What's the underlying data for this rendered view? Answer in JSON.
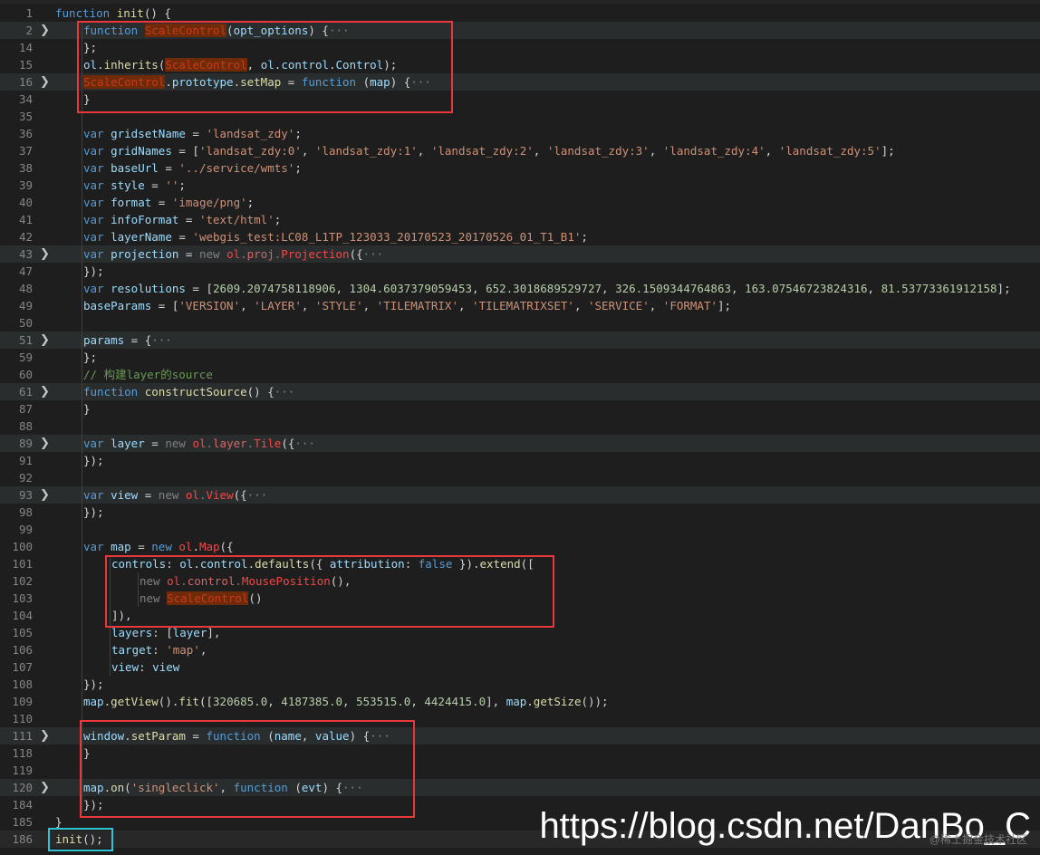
{
  "watermark": "https://blog.csdn.net/DanBo_C",
  "watermark_sub": "@稀土掘金技术社区",
  "lines": [
    {
      "n": "1",
      "fold": false,
      "indent": 0,
      "tokens": [
        [
          "k",
          "function "
        ],
        [
          "f",
          "init"
        ],
        [
          "d",
          "() {"
        ]
      ]
    },
    {
      "n": "2",
      "fold": true,
      "indent": 1,
      "tokens": [
        [
          "k",
          "function "
        ],
        [
          "hl",
          "ScaleControl"
        ],
        [
          "d",
          "("
        ],
        [
          "v",
          "opt_options"
        ],
        [
          "d",
          ") {"
        ],
        [
          "gray",
          "···"
        ]
      ]
    },
    {
      "n": "14",
      "fold": false,
      "indent": 1,
      "tokens": [
        [
          "d",
          "};"
        ]
      ]
    },
    {
      "n": "15",
      "fold": false,
      "indent": 1,
      "tokens": [
        [
          "v",
          "ol"
        ],
        [
          "d",
          "."
        ],
        [
          "f",
          "inherits"
        ],
        [
          "d",
          "("
        ],
        [
          "hl",
          "ScaleControl"
        ],
        [
          "d",
          ", "
        ],
        [
          "v",
          "ol"
        ],
        [
          "d",
          "."
        ],
        [
          "v",
          "control"
        ],
        [
          "d",
          "."
        ],
        [
          "v",
          "Control"
        ],
        [
          "d",
          ");"
        ]
      ]
    },
    {
      "n": "16",
      "fold": true,
      "indent": 1,
      "tokens": [
        [
          "hl",
          "ScaleControl"
        ],
        [
          "d",
          "."
        ],
        [
          "v",
          "prototype"
        ],
        [
          "d",
          "."
        ],
        [
          "f",
          "setMap"
        ],
        [
          "d",
          " = "
        ],
        [
          "k",
          "function "
        ],
        [
          "d",
          "("
        ],
        [
          "v",
          "map"
        ],
        [
          "d",
          ") {"
        ],
        [
          "gray",
          "···"
        ]
      ]
    },
    {
      "n": "34",
      "fold": false,
      "indent": 1,
      "tokens": [
        [
          "d",
          "}"
        ]
      ]
    },
    {
      "n": "35",
      "fold": false,
      "indent": 1,
      "tokens": []
    },
    {
      "n": "36",
      "fold": false,
      "indent": 1,
      "tokens": [
        [
          "k",
          "var "
        ],
        [
          "v",
          "gridsetName"
        ],
        [
          "d",
          " = "
        ],
        [
          "s",
          "'landsat_zdy'"
        ],
        [
          "d",
          ";"
        ]
      ]
    },
    {
      "n": "37",
      "fold": false,
      "indent": 1,
      "tokens": [
        [
          "k",
          "var "
        ],
        [
          "v",
          "gridNames"
        ],
        [
          "d",
          " = ["
        ],
        [
          "s",
          "'landsat_zdy:0'"
        ],
        [
          "d",
          ", "
        ],
        [
          "s",
          "'landsat_zdy:1'"
        ],
        [
          "d",
          ", "
        ],
        [
          "s",
          "'landsat_zdy:2'"
        ],
        [
          "d",
          ", "
        ],
        [
          "s",
          "'landsat_zdy:3'"
        ],
        [
          "d",
          ", "
        ],
        [
          "s",
          "'landsat_zdy:4'"
        ],
        [
          "d",
          ", "
        ],
        [
          "s",
          "'landsat_zdy:5'"
        ],
        [
          "d",
          "];"
        ]
      ]
    },
    {
      "n": "38",
      "fold": false,
      "indent": 1,
      "tokens": [
        [
          "k",
          "var "
        ],
        [
          "v",
          "baseUrl"
        ],
        [
          "d",
          " = "
        ],
        [
          "s",
          "'../service/wmts'"
        ],
        [
          "d",
          ";"
        ]
      ]
    },
    {
      "n": "39",
      "fold": false,
      "indent": 1,
      "tokens": [
        [
          "k",
          "var "
        ],
        [
          "v",
          "style"
        ],
        [
          "d",
          " = "
        ],
        [
          "s",
          "''"
        ],
        [
          "d",
          ";"
        ]
      ]
    },
    {
      "n": "40",
      "fold": false,
      "indent": 1,
      "tokens": [
        [
          "k",
          "var "
        ],
        [
          "v",
          "format"
        ],
        [
          "d",
          " = "
        ],
        [
          "s",
          "'image/png'"
        ],
        [
          "d",
          ";"
        ]
      ]
    },
    {
      "n": "41",
      "fold": false,
      "indent": 1,
      "tokens": [
        [
          "k",
          "var "
        ],
        [
          "v",
          "infoFormat"
        ],
        [
          "d",
          " = "
        ],
        [
          "s",
          "'text/html'"
        ],
        [
          "d",
          ";"
        ]
      ]
    },
    {
      "n": "42",
      "fold": false,
      "indent": 1,
      "tokens": [
        [
          "k",
          "var "
        ],
        [
          "v",
          "layerName"
        ],
        [
          "d",
          " = "
        ],
        [
          "s",
          "'webgis_test:LC08_L1TP_123033_20170523_20170526_01_T1_B1'"
        ],
        [
          "d",
          ";"
        ]
      ]
    },
    {
      "n": "43",
      "fold": true,
      "indent": 1,
      "tokens": [
        [
          "k",
          "var "
        ],
        [
          "v",
          "projection"
        ],
        [
          "d",
          " = "
        ],
        [
          "gray",
          "new "
        ],
        [
          "err",
          "ol"
        ],
        [
          "gray",
          "."
        ],
        [
          "err2",
          "proj"
        ],
        [
          "gray",
          "."
        ],
        [
          "err",
          "Projection"
        ],
        [
          "d",
          "({"
        ],
        [
          "gray",
          "···"
        ]
      ]
    },
    {
      "n": "47",
      "fold": false,
      "indent": 1,
      "tokens": [
        [
          "d",
          "});"
        ]
      ]
    },
    {
      "n": "48",
      "fold": false,
      "indent": 1,
      "tokens": [
        [
          "k",
          "var "
        ],
        [
          "v",
          "resolutions"
        ],
        [
          "d",
          " = ["
        ],
        [
          "n",
          "2609.2074758118906"
        ],
        [
          "d",
          ", "
        ],
        [
          "n",
          "1304.6037379059453"
        ],
        [
          "d",
          ", "
        ],
        [
          "n",
          "652.3018689529727"
        ],
        [
          "d",
          ", "
        ],
        [
          "n",
          "326.1509344764863"
        ],
        [
          "d",
          ", "
        ],
        [
          "n",
          "163.07546723824316"
        ],
        [
          "d",
          ", "
        ],
        [
          "n",
          "81.53773361912158"
        ],
        [
          "d",
          "];"
        ]
      ]
    },
    {
      "n": "49",
      "fold": false,
      "indent": 1,
      "tokens": [
        [
          "v",
          "baseParams"
        ],
        [
          "d",
          " = ["
        ],
        [
          "s",
          "'VERSION'"
        ],
        [
          "d",
          ", "
        ],
        [
          "s",
          "'LAYER'"
        ],
        [
          "d",
          ", "
        ],
        [
          "s",
          "'STYLE'"
        ],
        [
          "d",
          ", "
        ],
        [
          "s",
          "'TILEMATRIX'"
        ],
        [
          "d",
          ", "
        ],
        [
          "s",
          "'TILEMATRIXSET'"
        ],
        [
          "d",
          ", "
        ],
        [
          "s",
          "'SERVICE'"
        ],
        [
          "d",
          ", "
        ],
        [
          "s",
          "'FORMAT'"
        ],
        [
          "d",
          "];"
        ]
      ]
    },
    {
      "n": "50",
      "fold": false,
      "indent": 1,
      "tokens": []
    },
    {
      "n": "51",
      "fold": true,
      "indent": 1,
      "tokens": [
        [
          "v",
          "params"
        ],
        [
          "d",
          " = {"
        ],
        [
          "gray",
          "···"
        ]
      ]
    },
    {
      "n": "59",
      "fold": false,
      "indent": 1,
      "tokens": [
        [
          "d",
          "};"
        ]
      ]
    },
    {
      "n": "60",
      "fold": false,
      "indent": 1,
      "tokens": [
        [
          "c",
          "// 构建layer的source"
        ]
      ]
    },
    {
      "n": "61",
      "fold": true,
      "indent": 1,
      "tokens": [
        [
          "k",
          "function "
        ],
        [
          "f",
          "constructSource"
        ],
        [
          "d",
          "() {"
        ],
        [
          "gray",
          "···"
        ]
      ]
    },
    {
      "n": "87",
      "fold": false,
      "indent": 1,
      "tokens": [
        [
          "d",
          "}"
        ]
      ]
    },
    {
      "n": "88",
      "fold": false,
      "indent": 1,
      "tokens": []
    },
    {
      "n": "89",
      "fold": true,
      "indent": 1,
      "tokens": [
        [
          "k",
          "var "
        ],
        [
          "v",
          "layer"
        ],
        [
          "d",
          " = "
        ],
        [
          "gray",
          "new "
        ],
        [
          "err",
          "ol"
        ],
        [
          "gray",
          "."
        ],
        [
          "err2",
          "layer"
        ],
        [
          "gray",
          "."
        ],
        [
          "err",
          "Tile"
        ],
        [
          "d",
          "({"
        ],
        [
          "gray",
          "···"
        ]
      ]
    },
    {
      "n": "91",
      "fold": false,
      "indent": 1,
      "tokens": [
        [
          "d",
          "});"
        ]
      ]
    },
    {
      "n": "92",
      "fold": false,
      "indent": 1,
      "tokens": []
    },
    {
      "n": "93",
      "fold": true,
      "indent": 1,
      "tokens": [
        [
          "k",
          "var "
        ],
        [
          "v",
          "view"
        ],
        [
          "d",
          " = "
        ],
        [
          "gray",
          "new "
        ],
        [
          "err",
          "ol"
        ],
        [
          "gray",
          "."
        ],
        [
          "err",
          "View"
        ],
        [
          "d",
          "({"
        ],
        [
          "gray",
          "···"
        ]
      ]
    },
    {
      "n": "98",
      "fold": false,
      "indent": 1,
      "tokens": [
        [
          "d",
          "});"
        ]
      ]
    },
    {
      "n": "99",
      "fold": false,
      "indent": 1,
      "tokens": []
    },
    {
      "n": "100",
      "fold": false,
      "indent": 1,
      "tokens": [
        [
          "k",
          "var "
        ],
        [
          "v",
          "map"
        ],
        [
          "d",
          " = "
        ],
        [
          "k",
          "new "
        ],
        [
          "err",
          "ol"
        ],
        [
          "d",
          "."
        ],
        [
          "err",
          "Map"
        ],
        [
          "d",
          "({"
        ]
      ]
    },
    {
      "n": "101",
      "fold": false,
      "indent": 2,
      "tokens": [
        [
          "v",
          "controls"
        ],
        [
          "d",
          ": "
        ],
        [
          "v",
          "ol"
        ],
        [
          "d",
          "."
        ],
        [
          "v",
          "control"
        ],
        [
          "d",
          "."
        ],
        [
          "f",
          "defaults"
        ],
        [
          "d",
          "({ "
        ],
        [
          "v",
          "attribution"
        ],
        [
          "d",
          ": "
        ],
        [
          "k",
          "false"
        ],
        [
          "d",
          " })."
        ],
        [
          "f",
          "extend"
        ],
        [
          "d",
          "(["
        ]
      ]
    },
    {
      "n": "102",
      "fold": false,
      "indent": 3,
      "tokens": [
        [
          "gray",
          "new "
        ],
        [
          "err",
          "ol"
        ],
        [
          "gray",
          "."
        ],
        [
          "err2",
          "control"
        ],
        [
          "gray",
          "."
        ],
        [
          "err",
          "MousePosition"
        ],
        [
          "d",
          "(),"
        ]
      ]
    },
    {
      "n": "103",
      "fold": false,
      "indent": 3,
      "tokens": [
        [
          "gray",
          "new "
        ],
        [
          "hl",
          "ScaleControl"
        ],
        [
          "d",
          "()"
        ]
      ]
    },
    {
      "n": "104",
      "fold": false,
      "indent": 2,
      "tokens": [
        [
          "d",
          "]),"
        ]
      ]
    },
    {
      "n": "105",
      "fold": false,
      "indent": 2,
      "tokens": [
        [
          "v",
          "layers"
        ],
        [
          "d",
          ": ["
        ],
        [
          "v",
          "layer"
        ],
        [
          "d",
          "],"
        ]
      ]
    },
    {
      "n": "106",
      "fold": false,
      "indent": 2,
      "tokens": [
        [
          "v",
          "target"
        ],
        [
          "d",
          ": "
        ],
        [
          "s",
          "'map'"
        ],
        [
          "d",
          ","
        ]
      ]
    },
    {
      "n": "107",
      "fold": false,
      "indent": 2,
      "tokens": [
        [
          "v",
          "view"
        ],
        [
          "d",
          ": "
        ],
        [
          "v",
          "view"
        ]
      ]
    },
    {
      "n": "108",
      "fold": false,
      "indent": 1,
      "tokens": [
        [
          "d",
          "});"
        ]
      ]
    },
    {
      "n": "109",
      "fold": false,
      "indent": 1,
      "tokens": [
        [
          "v",
          "map"
        ],
        [
          "d",
          "."
        ],
        [
          "f",
          "getView"
        ],
        [
          "d",
          "()."
        ],
        [
          "f",
          "fit"
        ],
        [
          "d",
          "(["
        ],
        [
          "n",
          "320685.0"
        ],
        [
          "d",
          ", "
        ],
        [
          "n",
          "4187385.0"
        ],
        [
          "d",
          ", "
        ],
        [
          "n",
          "553515.0"
        ],
        [
          "d",
          ", "
        ],
        [
          "n",
          "4424415.0"
        ],
        [
          "d",
          "], "
        ],
        [
          "v",
          "map"
        ],
        [
          "d",
          "."
        ],
        [
          "f",
          "getSize"
        ],
        [
          "d",
          "());"
        ]
      ]
    },
    {
      "n": "110",
      "fold": false,
      "indent": 1,
      "tokens": []
    },
    {
      "n": "111",
      "fold": true,
      "indent": 1,
      "tokens": [
        [
          "v",
          "window"
        ],
        [
          "d",
          "."
        ],
        [
          "f",
          "setParam"
        ],
        [
          "d",
          " = "
        ],
        [
          "k",
          "function "
        ],
        [
          "d",
          "("
        ],
        [
          "v",
          "name"
        ],
        [
          "d",
          ", "
        ],
        [
          "v",
          "value"
        ],
        [
          "d",
          ") {"
        ],
        [
          "gray",
          "···"
        ]
      ]
    },
    {
      "n": "118",
      "fold": false,
      "indent": 1,
      "tokens": [
        [
          "d",
          "}"
        ]
      ]
    },
    {
      "n": "119",
      "fold": false,
      "indent": 1,
      "tokens": []
    },
    {
      "n": "120",
      "fold": true,
      "indent": 1,
      "tokens": [
        [
          "v",
          "map"
        ],
        [
          "d",
          "."
        ],
        [
          "f",
          "on"
        ],
        [
          "d",
          "("
        ],
        [
          "s",
          "'singleclick'"
        ],
        [
          "d",
          ", "
        ],
        [
          "k",
          "function "
        ],
        [
          "d",
          "("
        ],
        [
          "v",
          "evt"
        ],
        [
          "d",
          ") {"
        ],
        [
          "gray",
          "···"
        ]
      ]
    },
    {
      "n": "184",
      "fold": false,
      "indent": 1,
      "tokens": [
        [
          "d",
          "});"
        ]
      ]
    },
    {
      "n": "185",
      "fold": false,
      "indent": 0,
      "tokens": [
        [
          "d",
          "}"
        ]
      ]
    },
    {
      "n": "186",
      "fold": false,
      "indent": 0,
      "tokens": [
        [
          "f",
          "init"
        ],
        [
          "d",
          "();"
        ]
      ]
    }
  ]
}
